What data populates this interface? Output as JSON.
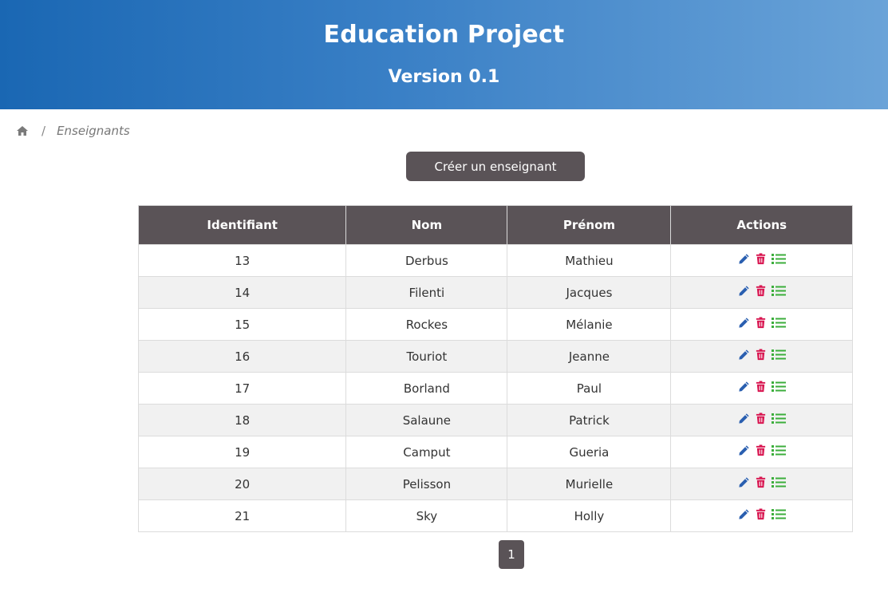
{
  "header": {
    "title": "Education Project",
    "subtitle": "Version 0.1"
  },
  "breadcrumb": {
    "home_icon": "home-icon",
    "separator": "/",
    "current": "Enseignants"
  },
  "create_button_label": "Créer un enseignant",
  "table": {
    "headers": [
      "Identifiant",
      "Nom",
      "Prénom",
      "Actions"
    ],
    "rows": [
      {
        "id": "13",
        "nom": "Derbus",
        "prenom": "Mathieu"
      },
      {
        "id": "14",
        "nom": "Filenti",
        "prenom": "Jacques"
      },
      {
        "id": "15",
        "nom": "Rockes",
        "prenom": "Mélanie"
      },
      {
        "id": "16",
        "nom": "Touriot",
        "prenom": "Jeanne"
      },
      {
        "id": "17",
        "nom": "Borland",
        "prenom": "Paul"
      },
      {
        "id": "18",
        "nom": "Salaune",
        "prenom": "Patrick"
      },
      {
        "id": "19",
        "nom": "Camput",
        "prenom": "Gueria"
      },
      {
        "id": "20",
        "nom": "Pelisson",
        "prenom": "Murielle"
      },
      {
        "id": "21",
        "nom": "Sky",
        "prenom": "Holly"
      }
    ],
    "action_icons": [
      "pencil-icon",
      "trash-icon",
      "list-icon"
    ]
  },
  "pagination": {
    "current_page": "1"
  },
  "colors": {
    "header_gradient_start": "#1a67b3",
    "header_gradient_end": "#6aa3d8",
    "dark_button": "#5a5357",
    "edit_icon": "#2a5fb0",
    "delete_icon": "#d8144f",
    "list_icon": "#3cae3c",
    "row_stripe": "#f1f1f1"
  }
}
